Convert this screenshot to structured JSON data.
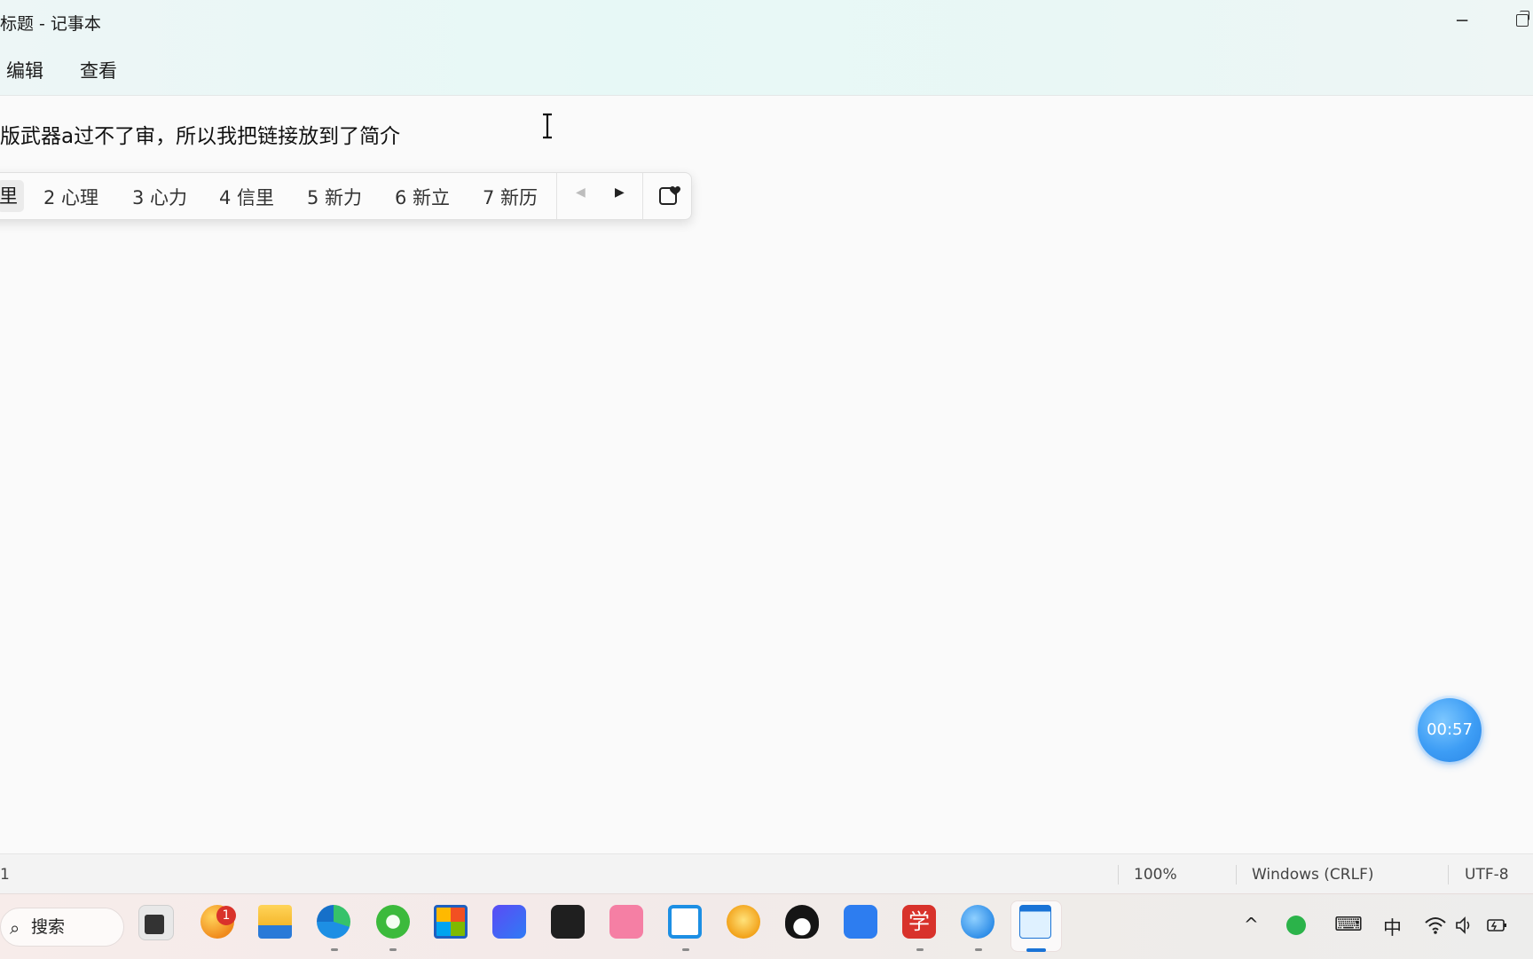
{
  "window": {
    "title": "标题 - 记事本",
    "minimize_glyph": "─",
    "menu": {
      "edit": "编辑",
      "view": "查看"
    }
  },
  "editor": {
    "text": "版武器a过不了审，所以我把链接放到了简介"
  },
  "ime": {
    "first_partial": "里",
    "candidates": [
      "2 心理",
      "3 心力",
      "4 信里",
      "5 新力",
      "6 新立",
      "7 新历"
    ],
    "prev_glyph": "◀",
    "next_glyph": "▶"
  },
  "timer": {
    "value": "00:57"
  },
  "status": {
    "position": "1",
    "zoom": "100%",
    "line_ending": "Windows (CRLF)",
    "encoding": "UTF-8"
  },
  "taskbar": {
    "search_label": "搜索",
    "notification_badge": "1",
    "icons": [
      "task-view",
      "browser-orange",
      "file-explorer",
      "edge",
      "browser-green",
      "microsoft-store",
      "app-blue",
      "terminal",
      "bilibili",
      "remote-app",
      "tiger-app",
      "qq",
      "feishu",
      "xue-app",
      "mail-app",
      "notepad"
    ],
    "tray": {
      "chevron": "^",
      "ime_lang": "中"
    }
  },
  "colors": {
    "accent": "#1a73d6",
    "timer": "#3d9df5",
    "badge": "#d9322b"
  }
}
